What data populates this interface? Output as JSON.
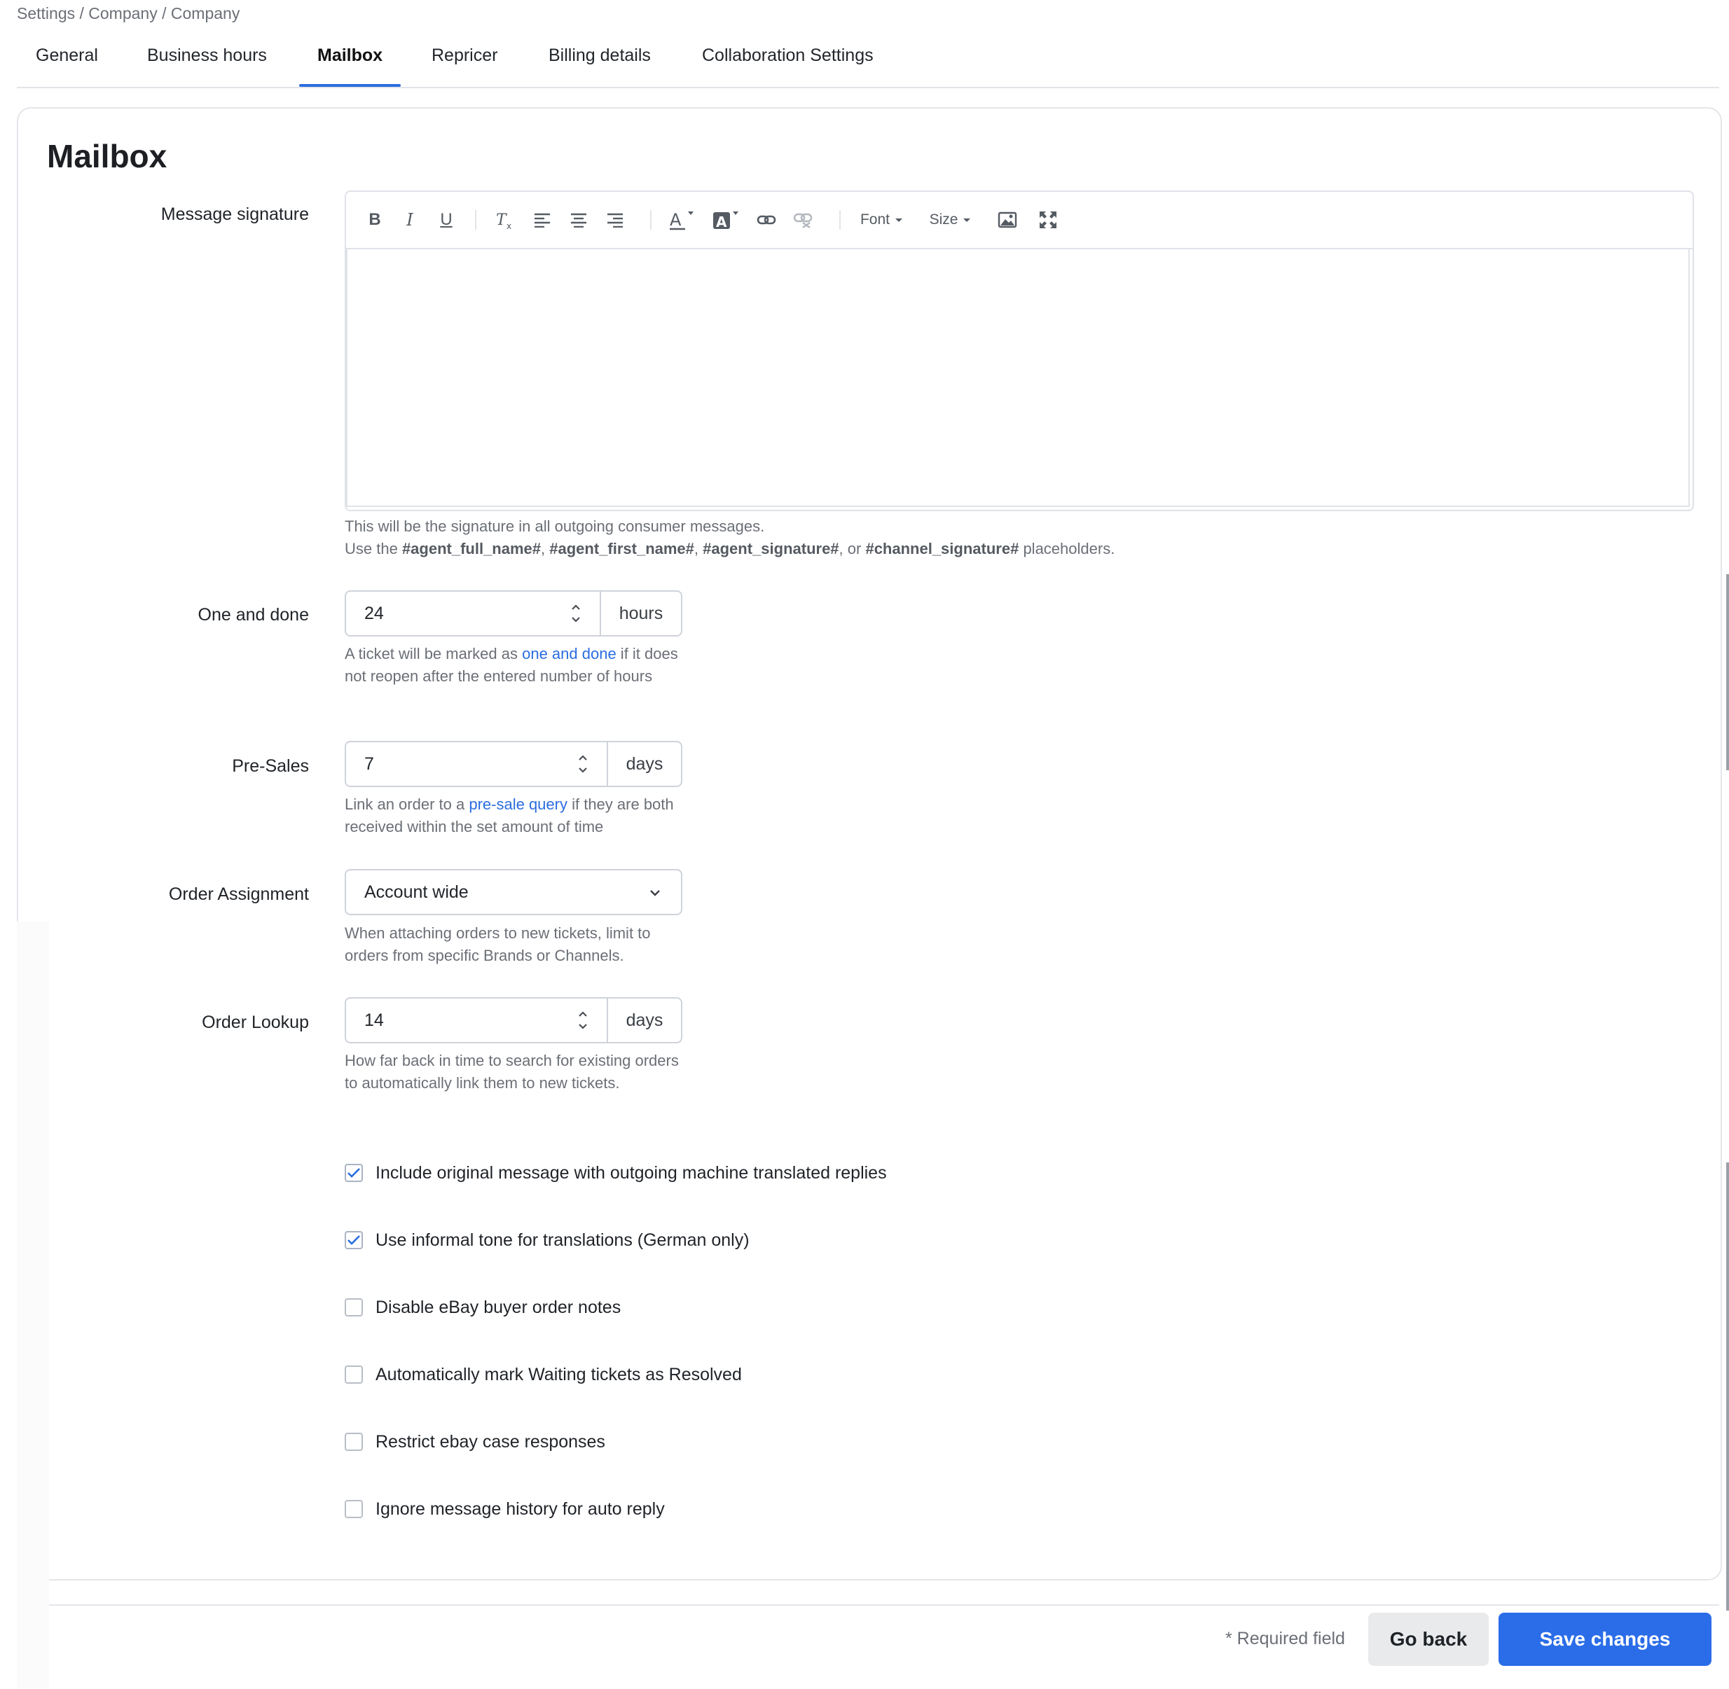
{
  "breadcrumb": "Settings / Company / Company",
  "tabs": [
    {
      "label": "General"
    },
    {
      "label": "Business hours"
    },
    {
      "label": "Mailbox"
    },
    {
      "label": "Repricer"
    },
    {
      "label": "Billing details"
    },
    {
      "label": "Collaboration Settings"
    }
  ],
  "active_tab": "Mailbox",
  "card": {
    "title": "Mailbox"
  },
  "signature": {
    "label": "Message signature",
    "toolbar": {
      "font_label": "Font",
      "size_label": "Size"
    },
    "help_line1": "This will be the signature in all outgoing consumer messages.",
    "help_prefix": "Use the ",
    "ph1": "#agent_full_name#",
    "ph2": "#agent_first_name#",
    "ph3": "#agent_signature#",
    "ph4": "#channel_signature#",
    "sep1": ", ",
    "sep2": ", ",
    "sep3": ", or ",
    "help_suffix": " placeholders."
  },
  "one_and_done": {
    "label": "One and done",
    "value": "24",
    "unit": "hours",
    "help_prefix": "A ticket will be marked as ",
    "help_link": "one and done",
    "help_suffix": " if it does not reopen after the entered number of hours"
  },
  "pre_sales": {
    "label": "Pre-Sales",
    "value": "7",
    "unit": "days",
    "help_prefix": "Link an order to a ",
    "help_link": "pre-sale query",
    "help_suffix": " if they are both received within the set amount of time"
  },
  "order_assignment": {
    "label": "Order Assignment",
    "selected": "Account wide",
    "help": "When attaching orders to new tickets, limit to orders from specific Brands or Channels."
  },
  "order_lookup": {
    "label": "Order Lookup",
    "value": "14",
    "unit": "days",
    "help": "How far back in time to search for existing orders to automatically link them to new tickets."
  },
  "checkboxes": [
    {
      "label": "Include original message with outgoing machine translated replies",
      "checked": true
    },
    {
      "label": "Use informal tone for translations (German only)",
      "checked": true
    },
    {
      "label": "Disable eBay buyer order notes",
      "checked": false
    },
    {
      "label": "Automatically mark Waiting tickets as Resolved",
      "checked": false
    },
    {
      "label": "Restrict ebay case responses",
      "checked": false
    },
    {
      "label": "Ignore message history for auto reply",
      "checked": false
    }
  ],
  "footer": {
    "required_text": "* Required field",
    "back_label": "Go back",
    "save_label": "Save changes"
  },
  "colors": {
    "accent": "#2b6de8",
    "link": "#2b6de0",
    "check": "#2b6de0"
  },
  "icons": [
    "bold-icon",
    "italic-icon",
    "underline-icon",
    "clear-format-icon",
    "align-left-icon",
    "align-center-icon",
    "align-right-icon",
    "text-color-icon",
    "highlight-color-icon",
    "link-icon",
    "unlink-icon",
    "image-icon",
    "fullscreen-icon",
    "chevron-down-icon",
    "checkmark-icon",
    "spinner-icon"
  ]
}
